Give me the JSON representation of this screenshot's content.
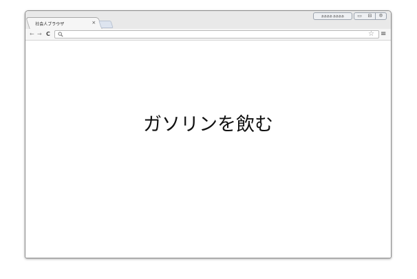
{
  "tab": {
    "title": "社会人ブラウザ",
    "close": "×"
  },
  "window_controls": {
    "profile_label": "ああああ ああああ",
    "minimize": "▭",
    "maximize": "⊟",
    "close": "ꕕ"
  },
  "toolbar": {
    "back": "←",
    "forward": "→",
    "reload": "C",
    "search_icon": "search-icon",
    "url": "",
    "star": "☆",
    "menu": "≡"
  },
  "page": {
    "headline": "ガソリンを飲む"
  }
}
